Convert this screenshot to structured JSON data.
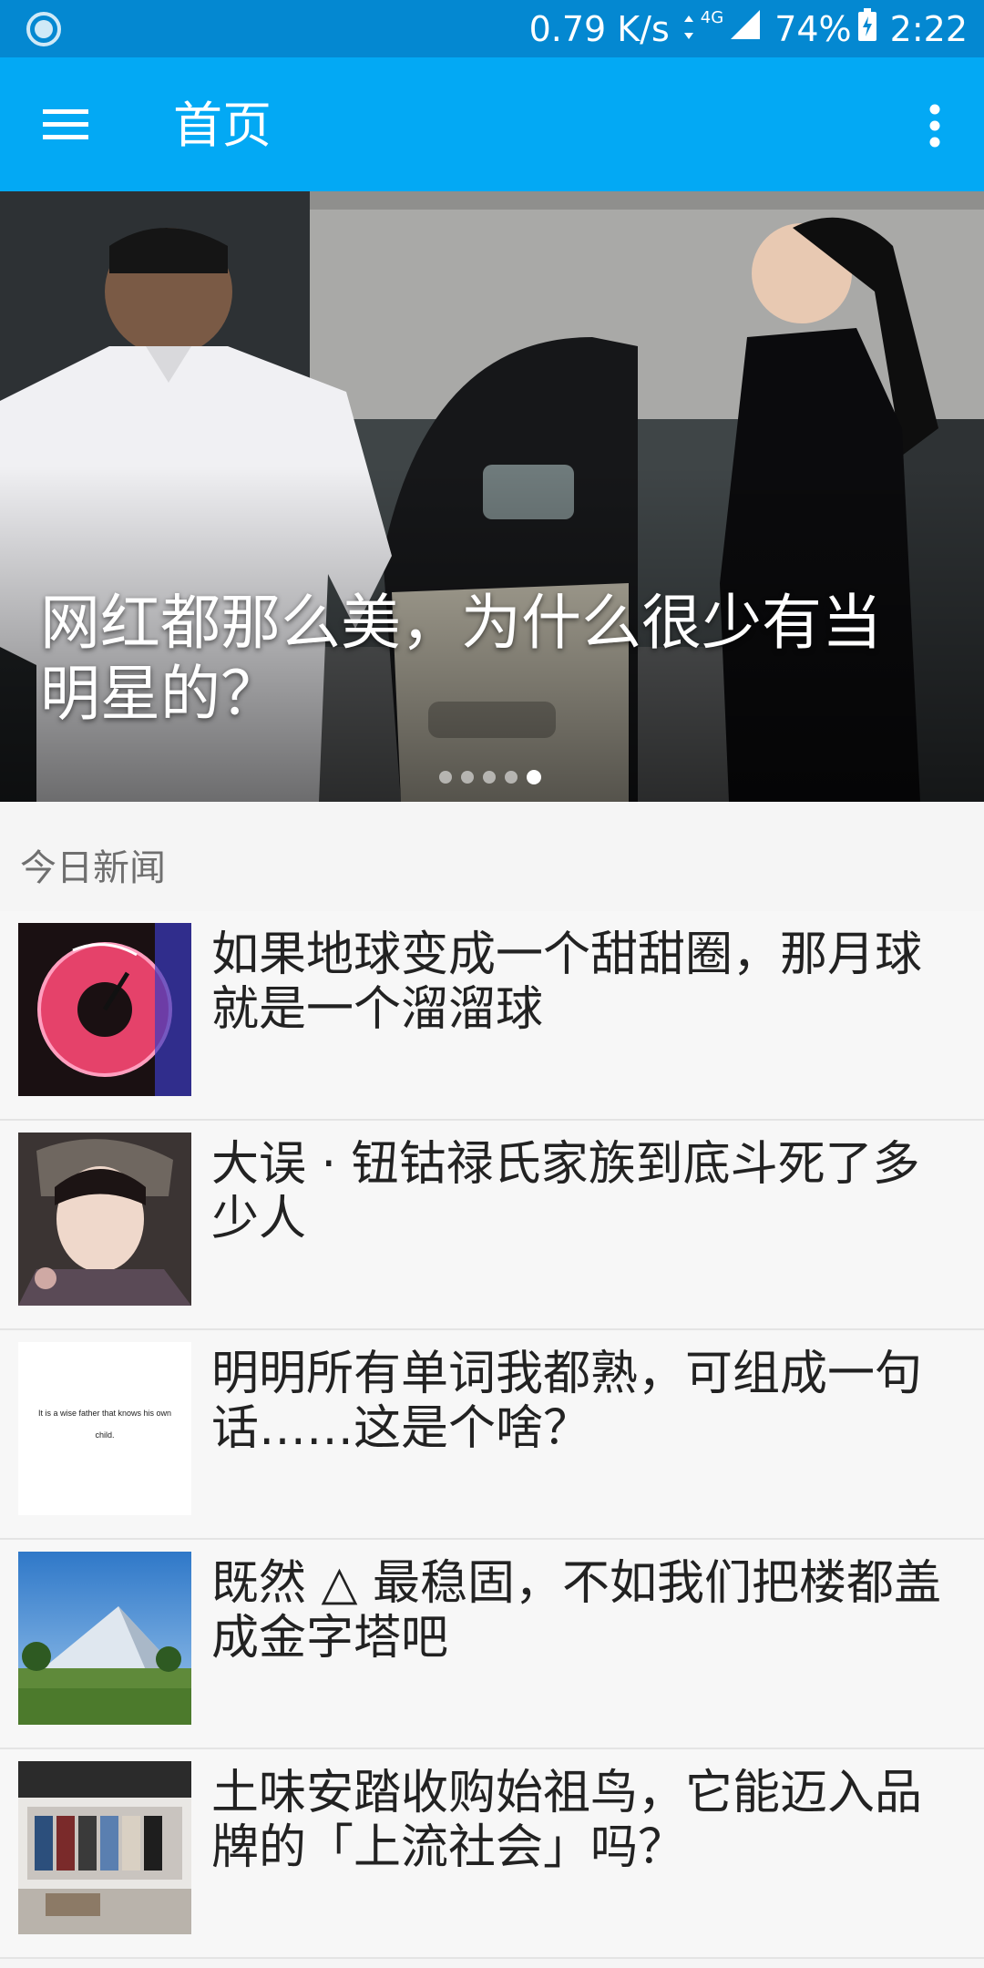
{
  "status_bar": {
    "net_speed": "0.79 K/s",
    "network": "4G",
    "battery": "74%",
    "time": "2:22",
    "colors": {
      "bg": "#0488d1"
    },
    "icons": [
      "loading-icon",
      "data-arrows-icon",
      "signal-icon",
      "battery-charging-icon"
    ]
  },
  "app_bar": {
    "title": "首页",
    "colors": {
      "bg": "#03a9f4"
    },
    "icons": [
      "menu-icon",
      "more-vert-icon"
    ]
  },
  "banner": {
    "title": "网红都那么美，为什么很少有当明星的？",
    "slides_total": 5,
    "active_slide": 5
  },
  "section": {
    "label": "今日新闻"
  },
  "news": [
    {
      "title": "如果地球变成一个甜甜圈，那月球就是一个溜溜球",
      "thumb": "donut-neon-thumbnail"
    },
    {
      "title": "大误 · 钮钴禄氏家族到底斗死了多少人",
      "thumb": "period-drama-woman-thumbnail"
    },
    {
      "title": "明明所有单词我都熟，可组成一句话……这是个啥？",
      "thumb": "text-quote-thumbnail",
      "thumb_text": "It is a wise father that knows his own child."
    },
    {
      "title": "既然 △ 最稳固，不如我们把楼都盖成金字塔吧",
      "thumb": "pyramid-building-thumbnail"
    },
    {
      "title": "土味安踏收购始祖鸟，它能迈入品牌的「上流社会」吗？",
      "thumb": "clothing-store-thumbnail"
    }
  ]
}
